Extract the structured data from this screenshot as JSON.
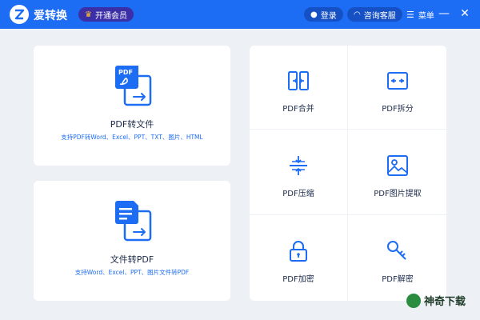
{
  "titlebar": {
    "app_title": "爱转换",
    "vip_label": "开通会员",
    "login_label": "登录",
    "service_label": "咨询客服",
    "menu_label": "菜单",
    "minimize_glyph": "—",
    "close_glyph": "✕",
    "colors": {
      "bar": "#1c6cf4",
      "vip_bg": "#3b2fa8",
      "crown": "#ffc42e"
    }
  },
  "cards": [
    {
      "title": "PDF转文件",
      "subtitle": "支持PDF转Word、Excel、PPT、TXT、图片、HTML",
      "icon": "pdf-to-file-icon"
    },
    {
      "title": "文件转PDF",
      "subtitle": "支持Word、Excel、PPT、图片文件转PDF",
      "icon": "file-to-pdf-icon"
    }
  ],
  "tools": [
    {
      "label": "PDF合并",
      "icon": "merge-icon"
    },
    {
      "label": "PDF拆分",
      "icon": "split-icon"
    },
    {
      "label": "PDF压缩",
      "icon": "compress-icon"
    },
    {
      "label": "PDF图片提取",
      "icon": "image-extract-icon"
    },
    {
      "label": "PDF加密",
      "icon": "lock-icon"
    },
    {
      "label": "PDF解密",
      "icon": "key-icon"
    }
  ],
  "watermark": {
    "text": "神奇下载"
  },
  "accent": "#1c6cf4"
}
